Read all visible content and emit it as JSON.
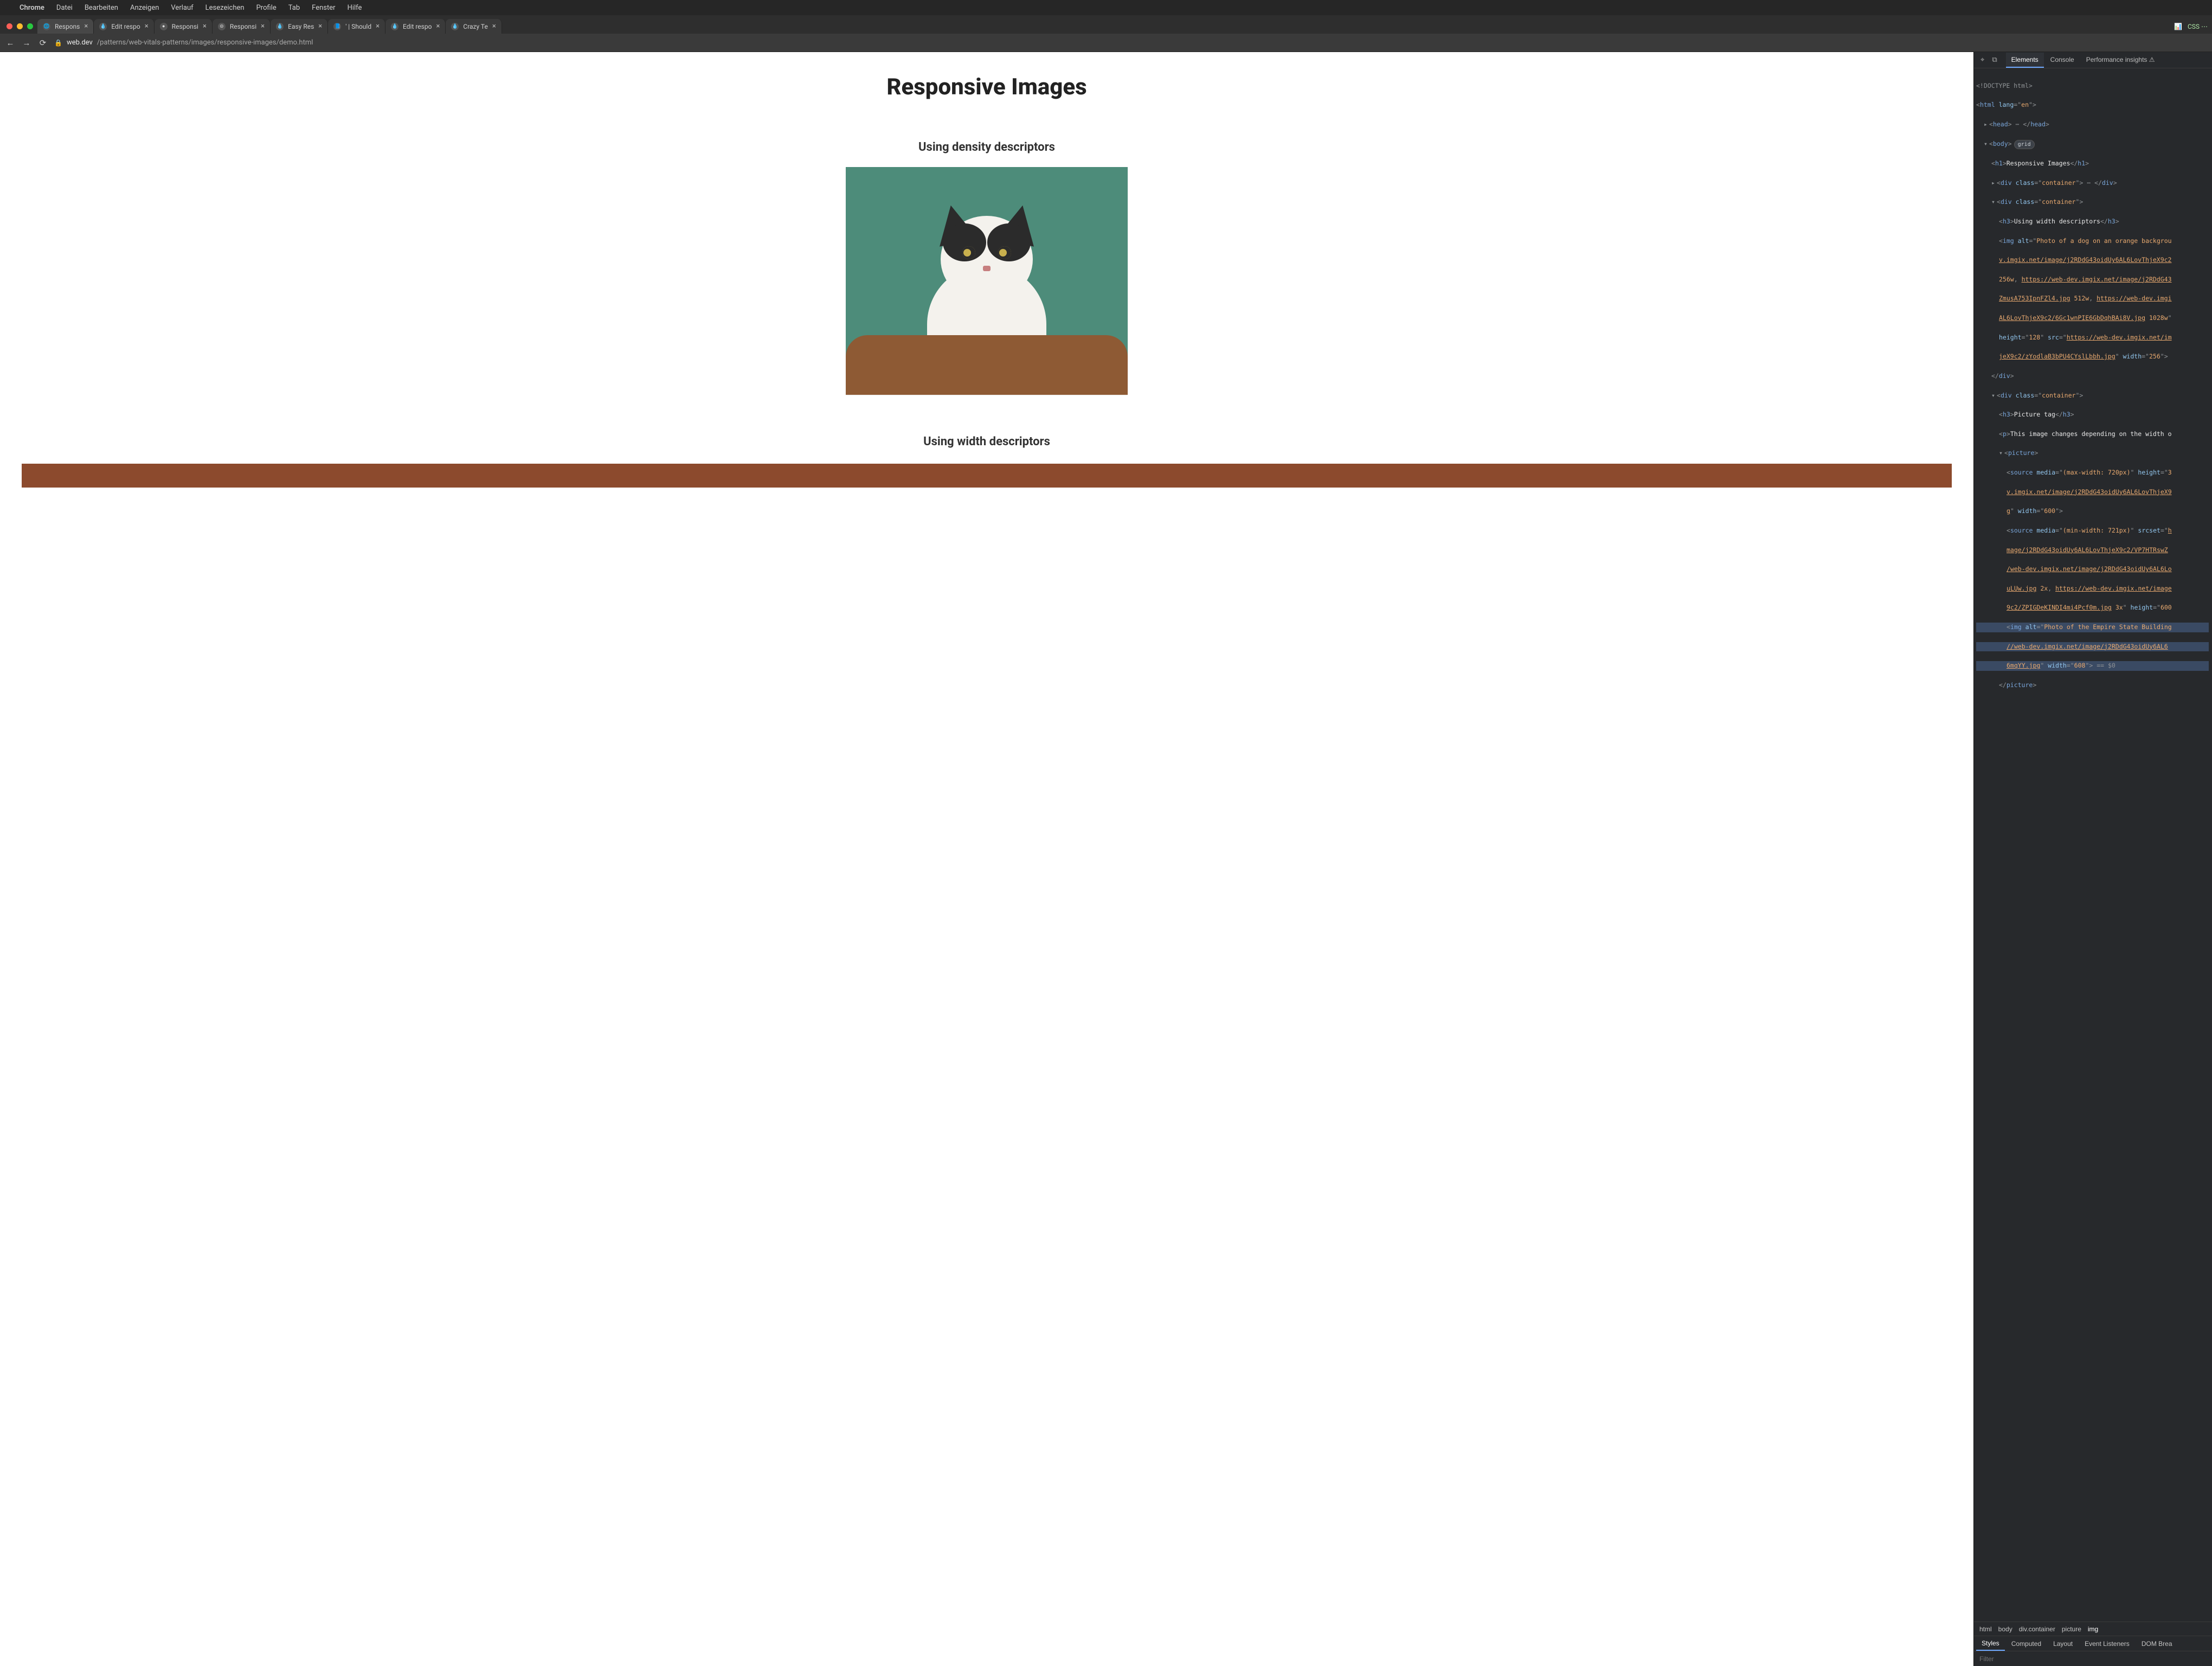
{
  "menubar": {
    "app": "Chrome",
    "items": [
      "Datei",
      "Bearbeiten",
      "Anzeigen",
      "Verlauf",
      "Lesezeichen",
      "Profile",
      "Tab",
      "Fenster",
      "Hilfe"
    ]
  },
  "tabs": [
    {
      "title": "Respons",
      "active": true,
      "fav": "🌐"
    },
    {
      "title": "Edit respo",
      "active": false,
      "fav": "💧"
    },
    {
      "title": "Responsi",
      "active": false,
      "fav": "●"
    },
    {
      "title": "Responsi",
      "active": false,
      "fav": "⊜"
    },
    {
      "title": "Easy Res",
      "active": false,
      "fav": "💧"
    },
    {
      "title": "' | Should",
      "active": false,
      "fav": "📘"
    },
    {
      "title": "Edit respo",
      "active": false,
      "fav": "💧"
    },
    {
      "title": "Crazy Te",
      "active": false,
      "fav": "💧"
    }
  ],
  "tabstrip_right": "CSS ⋯",
  "url": {
    "host": "web.dev",
    "path": "/patterns/web-vitals-patterns/images/responsive-images/demo.html"
  },
  "page": {
    "h1": "Responsive Images",
    "h3a": "Using density descriptors",
    "h3b": "Using width descriptors"
  },
  "devtools": {
    "tabs": [
      "Elements",
      "Console",
      "Performance insights ⚠"
    ],
    "active_tab": "Elements",
    "crumbs": [
      "html",
      "body",
      "div.container",
      "picture",
      "img"
    ],
    "subtabs": [
      "Styles",
      "Computed",
      "Layout",
      "Event Listeners",
      "DOM Brea"
    ],
    "active_subtab": "Styles",
    "filter_placeholder": "Filter",
    "elements": {
      "doctype": "<!DOCTYPE html>",
      "html_open": "html",
      "html_lang": "en",
      "head": "head",
      "body": "body",
      "body_pill": "grid",
      "h1_text": "Responsive Images",
      "container": "container",
      "h3_width": "Using width descriptors",
      "img_alt": "Photo of a dog on an orange backgrou",
      "srcset1": "v.imgix.net/image/j2RDdG43oidUy6AL6LovThjeX9c2",
      "srcset1_w": "256w",
      "srcset2": "https://web-dev.imgix.net/image/j2RDdG43",
      "srcset2b": "ZmusA753IpnFZl4.jpg",
      "srcset2_w": "512w",
      "srcset3": "https://web-dev.imgi",
      "srcset3b": "AL6LovThjeX9c2/6Gc1wnPIE6GbDqhBAi8V.jpg",
      "srcset3_w": "1028w",
      "img_h": "128",
      "img_src": "https://web-dev.imgix.net/im",
      "img_srcb": "jeX9c2/zYodlaB3bPU4CYslLbbh.jpg",
      "img_w": "256",
      "h3_pic": "Picture tag",
      "p_pic": "This image changes depending on the width o",
      "source1_media": "(max-width: 720px)",
      "source1_h": "3",
      "source1_src": "v.imgix.net/image/j2RDdG43oidUy6AL6LovThjeX9",
      "source1_end": "g",
      "source1_w": "600",
      "source2_media": "(min-width: 721px)",
      "source2_srcset": "h",
      "source2_l1": "mage/j2RDdG43oidUy6AL6LovThjeX9c2/VP7HTRswZ",
      "source2_l2": "/web-dev.imgix.net/image/j2RDdG43oidUy6AL6Lo",
      "source2_l3": "uLUw.jpg",
      "source2_2x": "2x",
      "source2_l4": "https://web-dev.imgix.net/image",
      "source2_l5": "9c2/ZPIGDeKINDI4mi4Pcf0m.jpg",
      "source2_3x": "3x",
      "source2_h": "600",
      "pic_img_alt": "Photo of the Empire State Building",
      "pic_img_src": "//web-dev.imgix.net/image/j2RDdG43oidUy6AL6",
      "pic_img_srcb": "6mqYY.jpg",
      "pic_img_w": "608",
      "eq0": " == $0"
    }
  }
}
